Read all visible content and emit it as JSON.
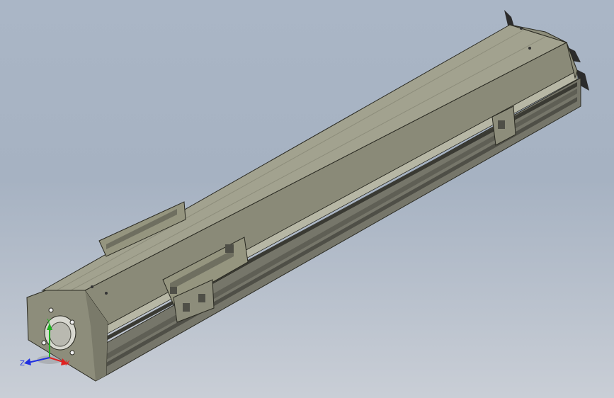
{
  "viewport": {
    "background_top": "#a7b3c3",
    "background_bottom": "#c7ccd4"
  },
  "model": {
    "part": "linear-actuator-module",
    "colors": {
      "body_top": "#9c9c8a",
      "body_side": "#7f7f6f",
      "end_cap": "#8d8d7b",
      "edge": "#2a2a22",
      "slot_dark": "#3a3a33"
    }
  },
  "triad": {
    "x_label": "X",
    "y_label": "Y",
    "z_label": "Z",
    "x_color": "#e02020",
    "y_color": "#20b020",
    "z_color": "#2030e0"
  }
}
